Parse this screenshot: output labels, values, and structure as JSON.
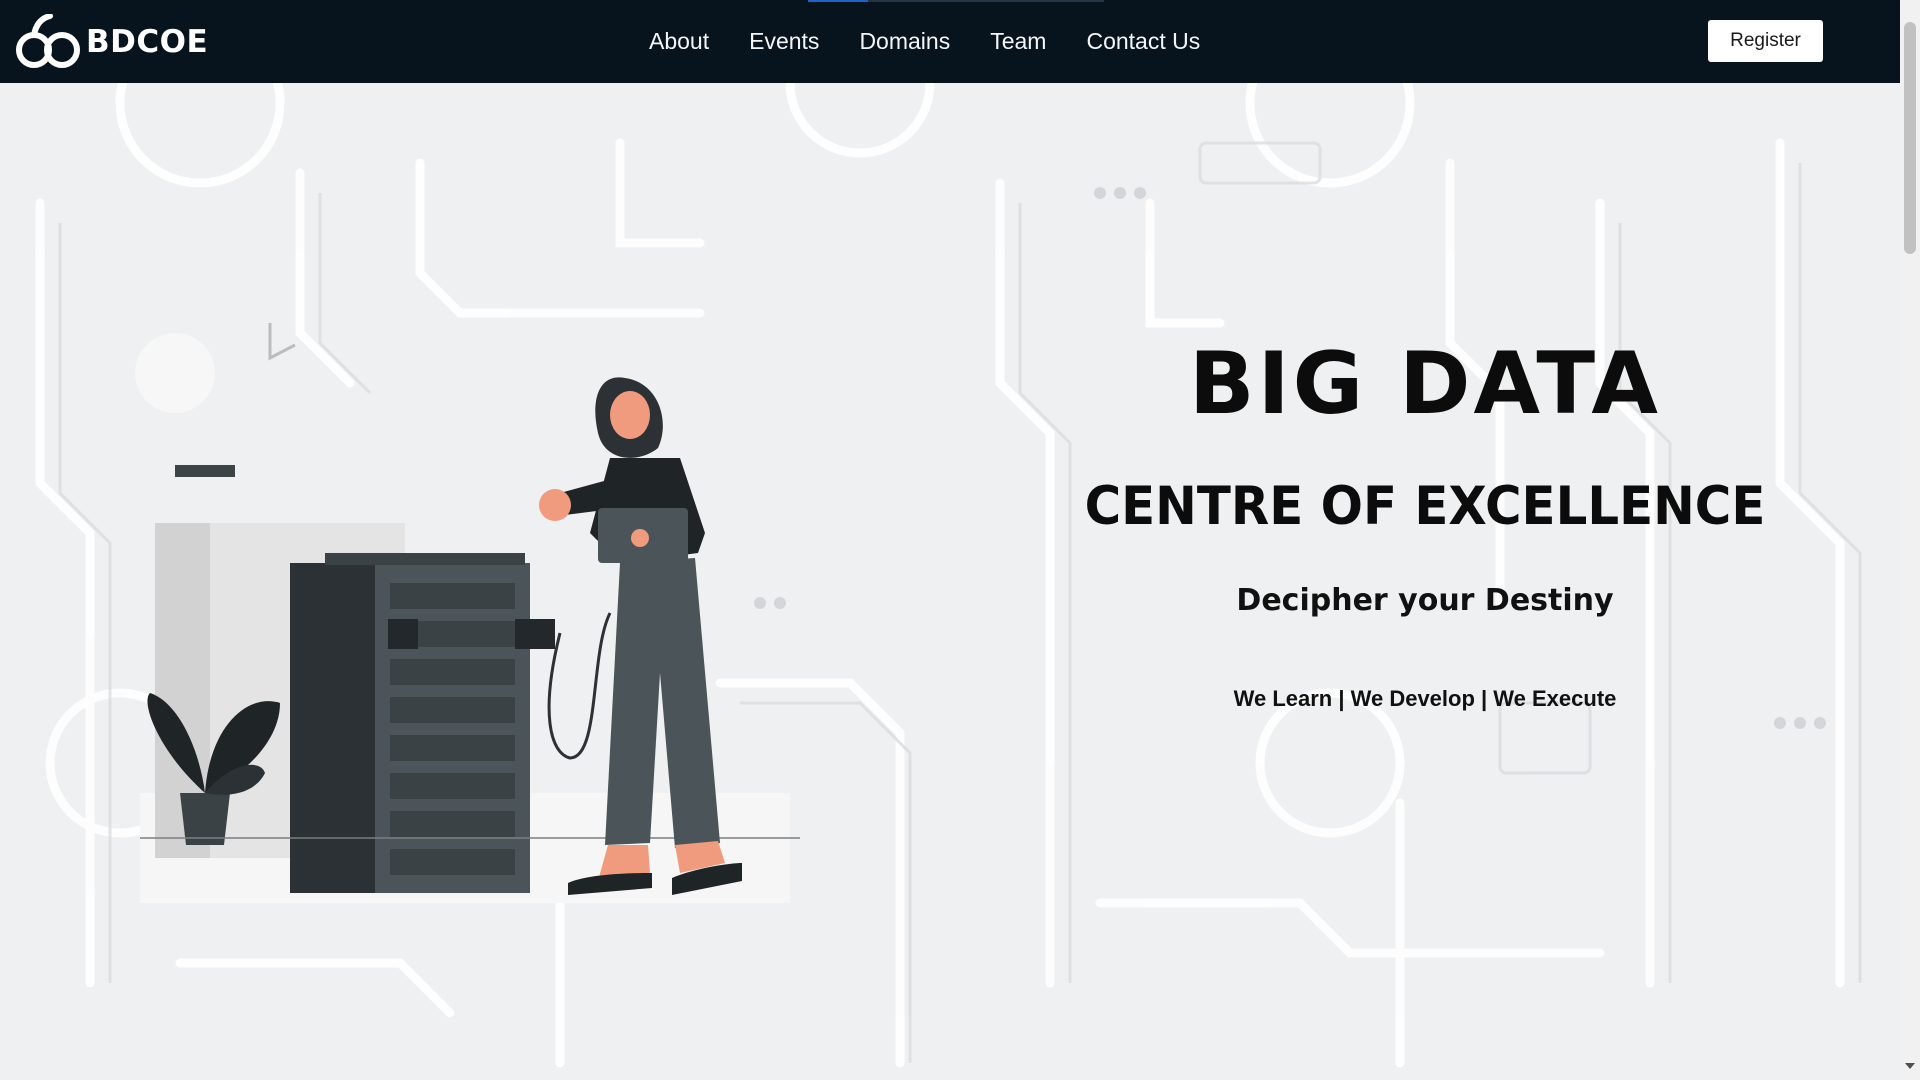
{
  "brand": {
    "name": "BDCOE"
  },
  "nav": {
    "links": [
      "About",
      "Events",
      "Domains",
      "Team",
      "Contact Us"
    ],
    "register_label": "Register"
  },
  "hero": {
    "title": "BIG DATA",
    "subtitle": "CENTRE OF EXCELLENCE",
    "tagline": "Decipher your Destiny",
    "motto": "We Learn | We Develop | We Execute"
  },
  "colors": {
    "navbar": "#07141d",
    "background": "#eef0f1",
    "text": "#0c0c0c",
    "accent": "#1f63c6"
  },
  "icons": {
    "logo": "bdcoe-logo-icon",
    "scroll_down": "chevron-down-icon"
  }
}
